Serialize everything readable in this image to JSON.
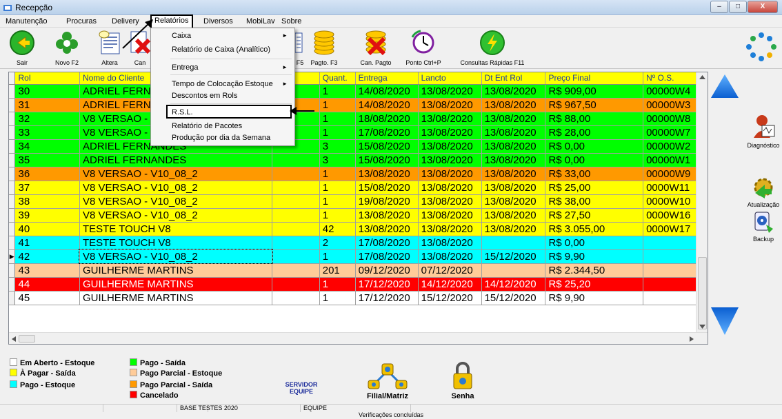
{
  "window": {
    "title": "Recepção",
    "min_label": "–",
    "max_label": "□",
    "close_label": "X"
  },
  "menu": [
    {
      "label": "Manutenção"
    },
    {
      "label": "Procuras"
    },
    {
      "label": "Delivery"
    },
    {
      "label": "Relatórios"
    },
    {
      "label": "Diversos"
    },
    {
      "label": "MobiLav"
    },
    {
      "label": "Sobre"
    }
  ],
  "toolbar": {
    "sair": "Sair",
    "novo": "Novo F2",
    "altera": "Altera",
    "cancel": "Can",
    "f5": "F5",
    "pagto": "Pagto. F3",
    "can_pagto": "Can. Pagto",
    "ponto": "Ponto Ctrl+P",
    "consultas": "Consultas Rápidas F11"
  },
  "dropdown": {
    "items": [
      {
        "label": "Caixa",
        "submenu": true
      },
      {
        "label": "Relatório de Caixa (Analítico)"
      },
      {
        "label": "Entrega",
        "submenu": true
      },
      {
        "label": "Tempo de Colocação Estoque",
        "submenu": true
      },
      {
        "label": "Descontos em Rols"
      },
      {
        "label": "R.S.L."
      },
      {
        "label": "Relatório de Pacotes"
      },
      {
        "label": "Produção por dia da Semana"
      }
    ],
    "submenu_arrow": "►"
  },
  "grid": {
    "headers": [
      "Rol",
      "Nome do Cliente",
      "",
      "Quant.",
      "Entrega",
      "Lancto",
      "Dt Ent Rol",
      "Preço Final",
      "Nº O.S."
    ],
    "current_row_marker": "▶",
    "rows": [
      {
        "rol": "30",
        "nome": "ADRIEL FERN",
        "quant": "1",
        "entrega": "14/08/2020",
        "lancto": "13/08/2020",
        "dt": "13/08/2020",
        "preco": "R$ 909,00",
        "os": "00000W4",
        "bg": "#00ff00",
        "fg": "#000"
      },
      {
        "rol": "31",
        "nome": "ADRIEL FERN",
        "quant": "1",
        "entrega": "14/08/2020",
        "lancto": "13/08/2020",
        "dt": "13/08/2020",
        "preco": "R$ 967,50",
        "os": "00000W3",
        "bg": "#ff9900",
        "fg": "#000"
      },
      {
        "rol": "32",
        "nome": "V8 VERSAO -",
        "quant": "1",
        "entrega": "18/08/2020",
        "lancto": "13/08/2020",
        "dt": "13/08/2020",
        "preco": "R$ 88,00",
        "os": "00000W8",
        "bg": "#00ff00",
        "fg": "#000"
      },
      {
        "rol": "33",
        "nome": "V8 VERSAO -",
        "quant": "1",
        "entrega": "17/08/2020",
        "lancto": "13/08/2020",
        "dt": "13/08/2020",
        "preco": "R$ 28,00",
        "os": "00000W7",
        "bg": "#00ff00",
        "fg": "#000"
      },
      {
        "rol": "34",
        "nome": "ADRIEL FERNANDES",
        "quant": "3",
        "entrega": "15/08/2020",
        "lancto": "13/08/2020",
        "dt": "13/08/2020",
        "preco": "R$ 0,00",
        "os": "00000W2",
        "bg": "#00ff00",
        "fg": "#000"
      },
      {
        "rol": "35",
        "nome": "ADRIEL FERNANDES",
        "quant": "3",
        "entrega": "15/08/2020",
        "lancto": "13/08/2020",
        "dt": "13/08/2020",
        "preco": "R$ 0,00",
        "os": "00000W1",
        "bg": "#00ff00",
        "fg": "#000"
      },
      {
        "rol": "36",
        "nome": "V8 VERSAO - V10_08_2",
        "quant": "1",
        "entrega": "13/08/2020",
        "lancto": "13/08/2020",
        "dt": "13/08/2020",
        "preco": "R$ 33,00",
        "os": "00000W9",
        "bg": "#ff9900",
        "fg": "#000"
      },
      {
        "rol": "37",
        "nome": "V8 VERSAO - V10_08_2",
        "quant": "1",
        "entrega": "15/08/2020",
        "lancto": "13/08/2020",
        "dt": "13/08/2020",
        "preco": "R$ 25,00",
        "os": "0000W11",
        "bg": "#ffff00",
        "fg": "#000"
      },
      {
        "rol": "38",
        "nome": "V8 VERSAO - V10_08_2",
        "quant": "1",
        "entrega": "19/08/2020",
        "lancto": "13/08/2020",
        "dt": "13/08/2020",
        "preco": "R$ 38,00",
        "os": "0000W10",
        "bg": "#ffff00",
        "fg": "#000"
      },
      {
        "rol": "39",
        "nome": "V8 VERSAO - V10_08_2",
        "quant": "1",
        "entrega": "13/08/2020",
        "lancto": "13/08/2020",
        "dt": "13/08/2020",
        "preco": "R$ 27,50",
        "os": "0000W16",
        "bg": "#ffff00",
        "fg": "#000"
      },
      {
        "rol": "40",
        "nome": "TESTE TOUCH V8",
        "quant": "42",
        "entrega": "13/08/2020",
        "lancto": "13/08/2020",
        "dt": "13/08/2020",
        "preco": "R$ 3.055,00",
        "os": "0000W17",
        "bg": "#ffff00",
        "fg": "#000"
      },
      {
        "rol": "41",
        "nome": "TESTE TOUCH V8",
        "quant": "2",
        "entrega": "17/08/2020",
        "lancto": "13/08/2020",
        "dt": "",
        "preco": "R$ 0,00",
        "os": "",
        "bg": "#00ffff",
        "fg": "#000"
      },
      {
        "rol": "42",
        "nome": "V8 VERSAO - V10_08_2",
        "quant": "1",
        "entrega": "17/08/2020",
        "lancto": "13/08/2020",
        "dt": "15/12/2020",
        "preco": "R$ 9,90",
        "os": "",
        "bg": "#00ffff",
        "fg": "#000",
        "current": true
      },
      {
        "rol": "43",
        "nome": "GUILHERME MARTINS",
        "quant": "201",
        "entrega": "09/12/2020",
        "lancto": "07/12/2020",
        "dt": "",
        "preco": "R$ 2.344,50",
        "os": "",
        "bg": "#ffcc99",
        "fg": "#000"
      },
      {
        "rol": "44",
        "nome": "GUILHERME MARTINS",
        "quant": "1",
        "entrega": "17/12/2020",
        "lancto": "14/12/2020",
        "dt": "14/12/2020",
        "preco": "R$ 25,20",
        "os": "",
        "bg": "#ff0000",
        "fg": "#ffffff"
      },
      {
        "rol": "45",
        "nome": "GUILHERME MARTINS",
        "quant": "1",
        "entrega": "17/12/2020",
        "lancto": "15/12/2020",
        "dt": "15/12/2020",
        "preco": "R$ 9,90",
        "os": "",
        "bg": "#ffffff",
        "fg": "#000"
      }
    ]
  },
  "sidebar": {
    "diagnostico": "Diagnóstico",
    "atualizacao": "Atualização",
    "backup": "Backup"
  },
  "legend": [
    {
      "label": "Em Aberto - Estoque",
      "color": "#ffffff"
    },
    {
      "label": "À Pagar - Saída",
      "color": "#ffff00"
    },
    {
      "label": "Pago - Estoque",
      "color": "#00ffff"
    },
    {
      "label": "Pago - Saída",
      "color": "#00ff00"
    },
    {
      "label": "Pago Parcial - Estoque",
      "color": "#ffcc99"
    },
    {
      "label": "Pago Parcial - Saída",
      "color": "#ff9900"
    },
    {
      "label": "Cancelado",
      "color": "#ff0000"
    }
  ],
  "bottom": {
    "servidor": "SERVIDOR",
    "equipe": "EQUIPE",
    "filial": "Filial/Matriz",
    "senha": "Senha"
  },
  "status": {
    "base": "BASE TESTES 2020",
    "user": "EQUIPE",
    "message": "Verificações concluídas"
  }
}
